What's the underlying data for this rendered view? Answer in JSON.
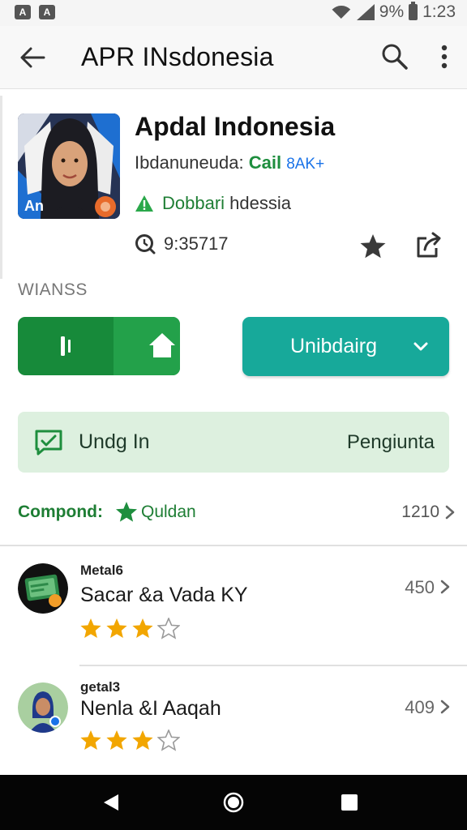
{
  "status_bar": {
    "left_icons": [
      "A",
      "A"
    ],
    "battery_text": "9%",
    "time": "1:23"
  },
  "app_bar": {
    "title": "APR INsdonesia",
    "back_icon": "arrow-left-icon",
    "search_icon": "search-icon",
    "more_icon": "more-vert-icon"
  },
  "app": {
    "name": "Apdal Indonesia",
    "developer_prefix": "Ibdanuneuda:",
    "developer_green": "Cail",
    "developer_blue": "8AK+",
    "category_green": "Dobbari",
    "category_rest": "hdessia",
    "meta_value": "9:35717",
    "icon_badge": "An"
  },
  "section_label": "WIANSS",
  "actions": {
    "primary_label": "Unibdairg"
  },
  "promo": {
    "left_label": "Undg In",
    "right_label": "Pengiunta"
  },
  "rating": {
    "label": "Compond:",
    "value": "Quldan",
    "count": "1210"
  },
  "reviews": [
    {
      "small_label": "Metal6",
      "title": "Sacar &a Vada KY",
      "count": "450",
      "stars_filled": 3,
      "stars_total": 4
    },
    {
      "small_label": "getal3",
      "title": "Nenla &I Aaqah",
      "count": "409",
      "stars_filled": 3,
      "stars_total": 4
    }
  ],
  "colors": {
    "green": "#178a3a",
    "green_light": "#23a14a",
    "teal": "#17a99a",
    "promo_bg": "#ddf0df",
    "star_gold": "#f2a600"
  }
}
